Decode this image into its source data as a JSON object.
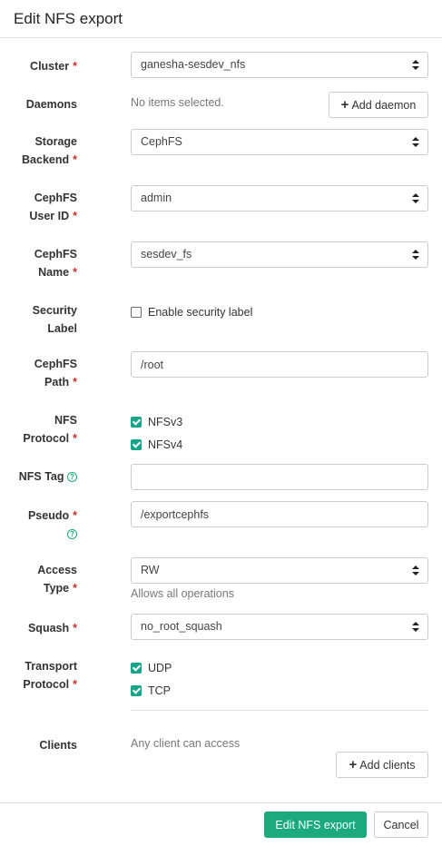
{
  "header": {
    "title": "Edit NFS export"
  },
  "form": {
    "cluster": {
      "label": "Cluster",
      "value": "ganesha-sesdev_nfs"
    },
    "daemons": {
      "label": "Daemons",
      "empty_text": "No items selected.",
      "add_label": "Add daemon"
    },
    "storage_backend": {
      "label_1": "Storage",
      "label_2": "Backend",
      "value": "CephFS"
    },
    "cephfs_user": {
      "label_1": "CephFS",
      "label_2": "User ID",
      "value": "admin"
    },
    "cephfs_name": {
      "label_1": "CephFS",
      "label_2": "Name",
      "value": "sesdev_fs"
    },
    "security_label": {
      "label_1": "Security",
      "label_2": "Label",
      "checkbox_label": "Enable security label",
      "checked": false
    },
    "cephfs_path": {
      "label_1": "CephFS",
      "label_2": "Path",
      "value": "/root"
    },
    "nfs_protocol": {
      "label_1": "NFS",
      "label_2": "Protocol",
      "options": [
        {
          "label": "NFSv3",
          "checked": true
        },
        {
          "label": "NFSv4",
          "checked": true
        }
      ]
    },
    "nfs_tag": {
      "label": "NFS Tag",
      "value": ""
    },
    "pseudo": {
      "label": "Pseudo",
      "value": "/exportcephfs"
    },
    "access_type": {
      "label_1": "Access",
      "label_2": "Type",
      "value": "RW",
      "help": "Allows all operations"
    },
    "squash": {
      "label": "Squash",
      "value": "no_root_squash"
    },
    "transport": {
      "label_1": "Transport",
      "label_2": "Protocol",
      "options": [
        {
          "label": "UDP",
          "checked": true
        },
        {
          "label": "TCP",
          "checked": true
        }
      ]
    },
    "clients": {
      "label": "Clients",
      "empty_text": "Any client can access",
      "add_label": "Add clients"
    }
  },
  "footer": {
    "submit_label": "Edit NFS export",
    "cancel_label": "Cancel"
  },
  "colors": {
    "accent": "#1aaa7b",
    "required": "#c9302c"
  }
}
